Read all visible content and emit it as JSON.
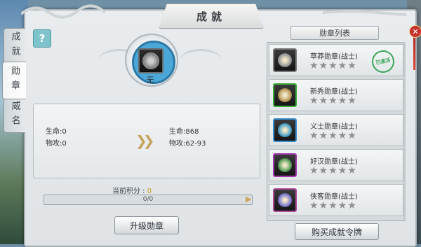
{
  "window": {
    "title": "成就"
  },
  "tabs": [
    {
      "label": "成就"
    },
    {
      "label": "勋章"
    },
    {
      "label": "威名"
    }
  ],
  "help": {
    "label": "?"
  },
  "current_medal": {
    "name": "无"
  },
  "stats": {
    "current": {
      "hp": "生命:0",
      "atk": "物攻:0"
    },
    "next": {
      "hp": "生命:868",
      "atk": "物攻:62-93"
    }
  },
  "progress": {
    "label": "当前积分 : ",
    "points": "0",
    "bar_text": "0/0",
    "fraction": 0
  },
  "upgrade_button": "升级勋章",
  "medal_list": {
    "header": "勋章列表",
    "items": [
      {
        "name": "草莽勋章(战士)",
        "stars": "★★★★★",
        "stamp": "已激活",
        "border": "#7a7a7a",
        "coin": "#9a9a9a"
      },
      {
        "name": "新秀勋章(战士)",
        "stars": "★★★★★",
        "border": "#3cae3c",
        "coin": "#b89a5a"
      },
      {
        "name": "义士勋章(战士)",
        "stars": "★★★★★",
        "border": "#3a8fd0",
        "coin": "#4fa3c9"
      },
      {
        "name": "好汉勋章(战士)",
        "stars": "★★★★★",
        "border": "#a23bb0",
        "coin": "#5aa05a"
      },
      {
        "name": "侠客勋章(战士)",
        "stars": "★★★★★",
        "border": "#b04a9c",
        "coin": "#7d7ad0"
      }
    ]
  },
  "buy_button": "购买成就令牌",
  "close": {
    "label": "✕"
  }
}
